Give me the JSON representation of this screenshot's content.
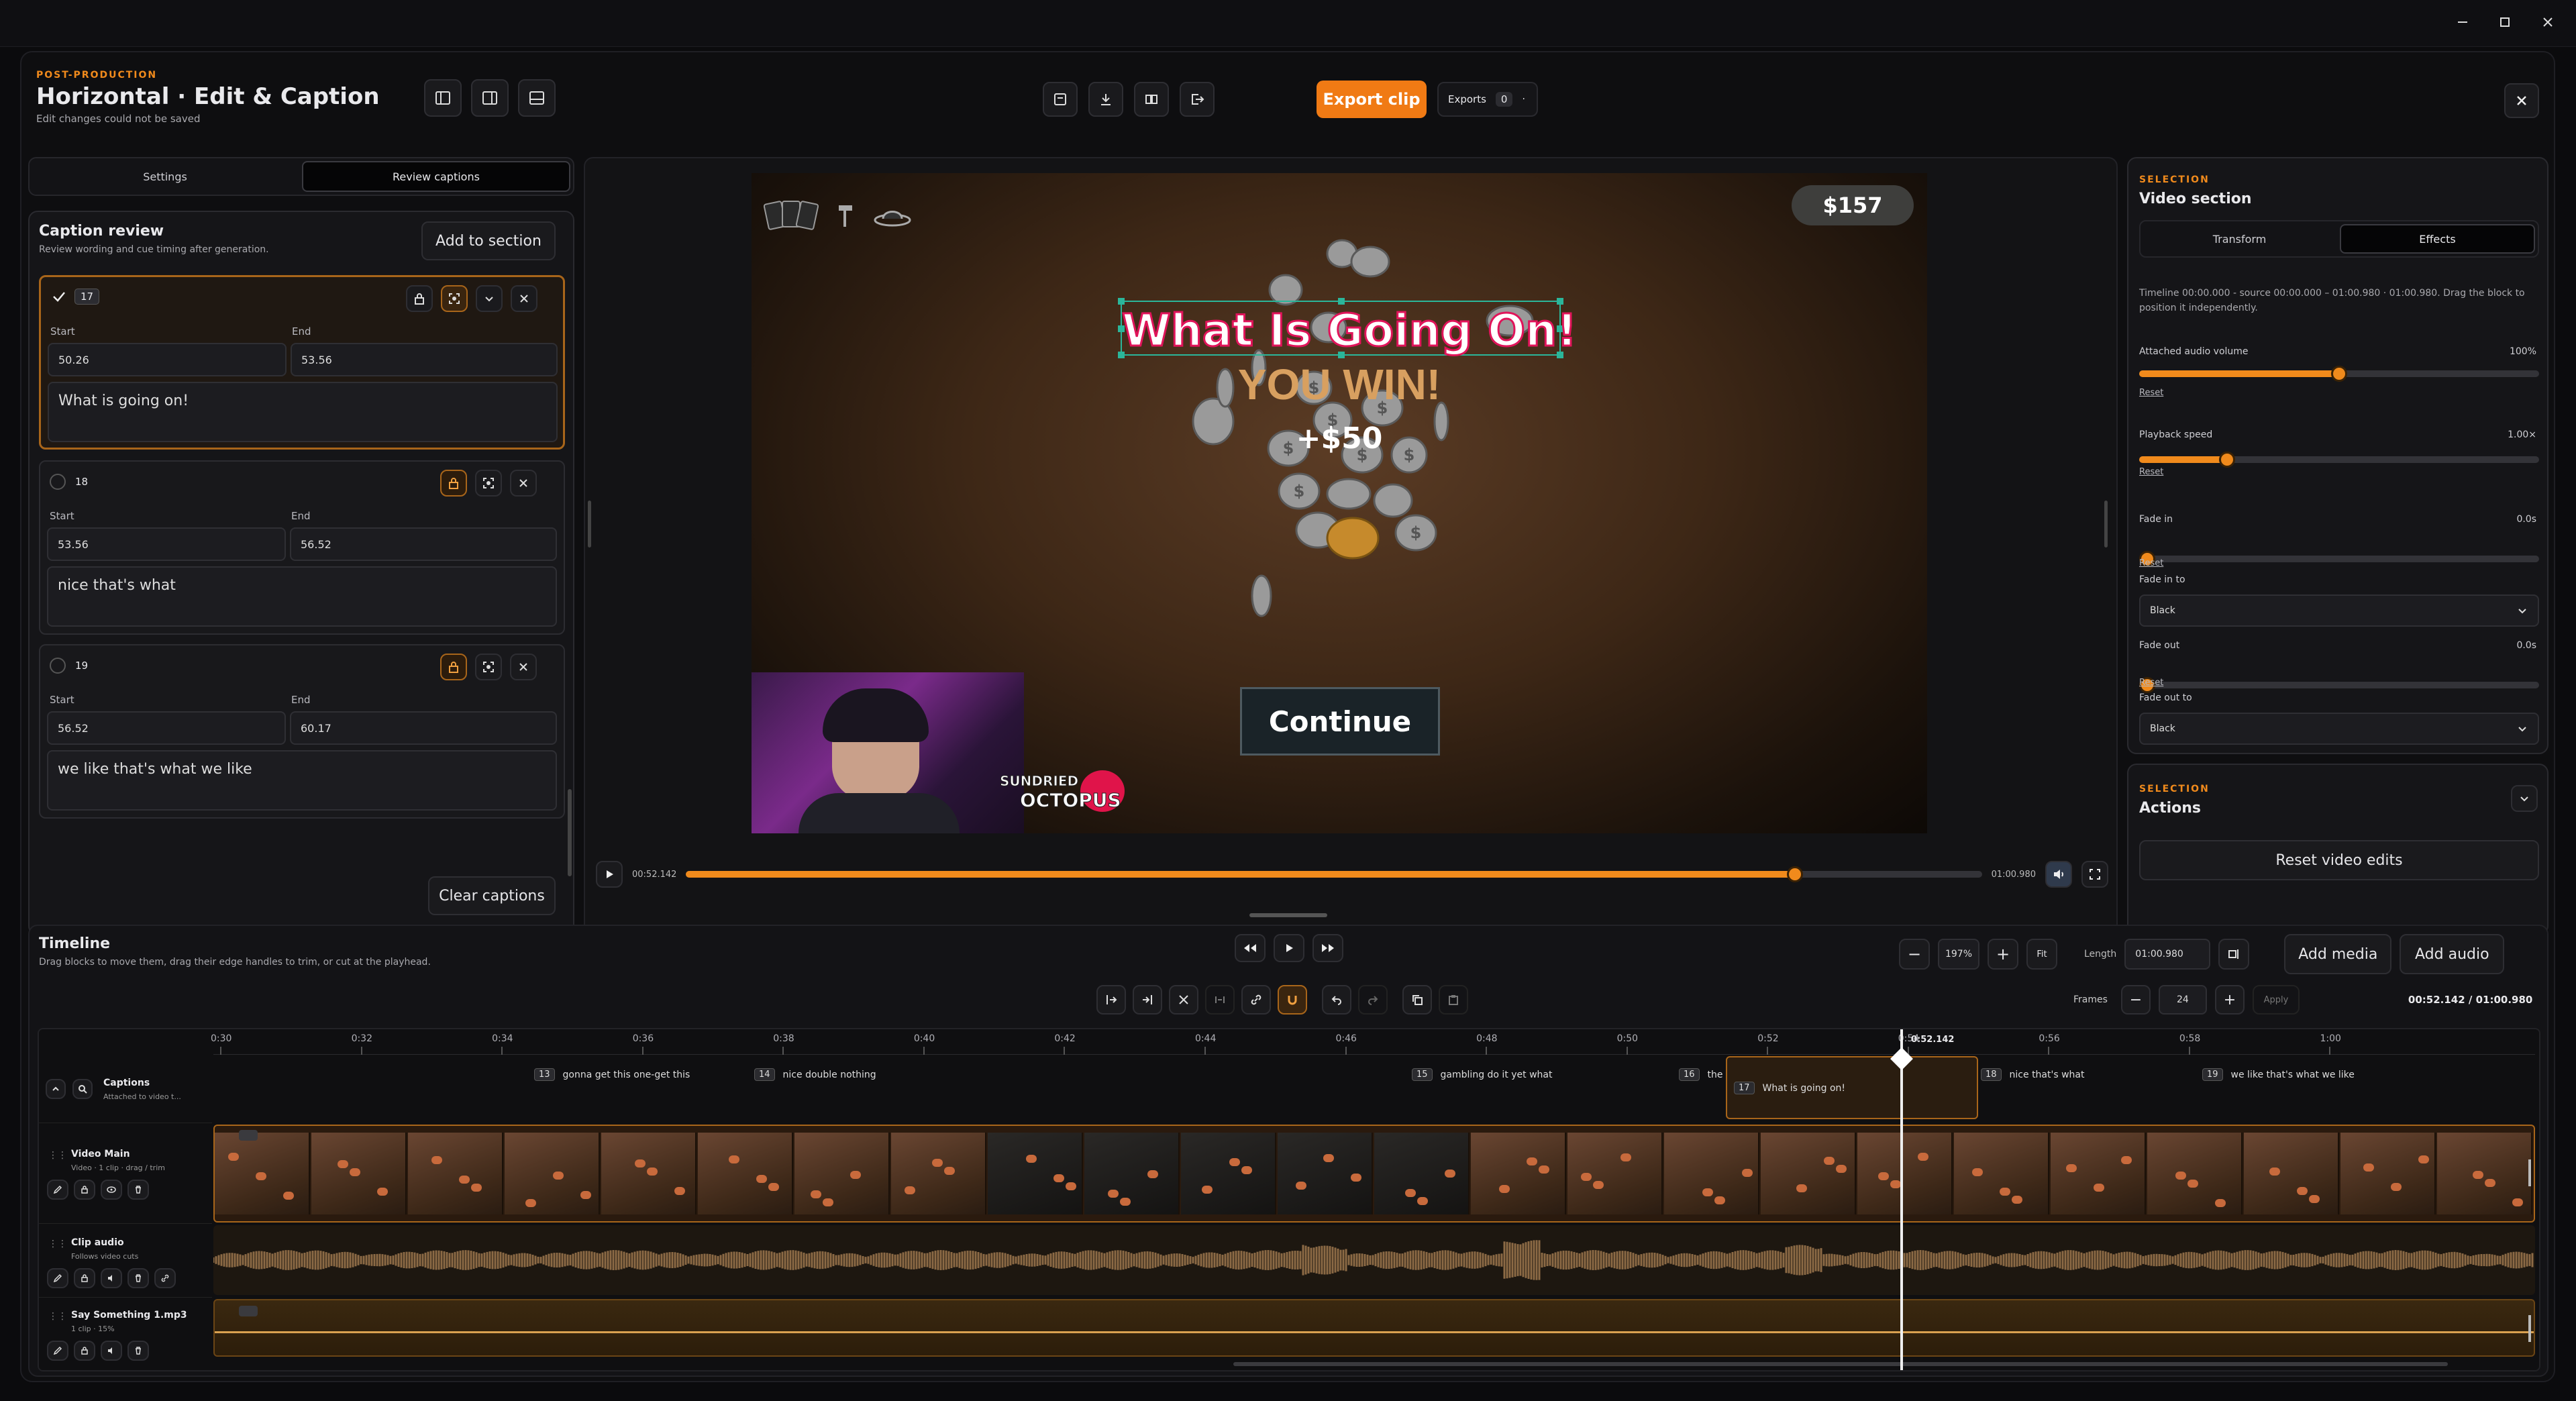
{
  "header": {
    "eyebrow": "POST-PRODUCTION",
    "title": "Horizontal · Edit & Caption",
    "subtitle": "Edit changes could not be saved",
    "export_label": "Export clip",
    "exports_label": "Exports",
    "exports_count": "0"
  },
  "left_panel": {
    "tabs": [
      {
        "label": "Settings"
      },
      {
        "label": "Review captions"
      }
    ],
    "title": "Caption review",
    "description": "Review wording and cue timing after generation.",
    "add_section": "Add to section",
    "clear": "Clear captions",
    "start_label": "Start",
    "end_label": "End",
    "cues": [
      {
        "num": "17",
        "start": "50.26",
        "end": "53.56",
        "text": "What is going on!"
      },
      {
        "num": "18",
        "start": "53.56",
        "end": "56.52",
        "text": "nice that's what"
      },
      {
        "num": "19",
        "start": "56.52",
        "end": "60.17",
        "text": "we like that's what we like"
      }
    ]
  },
  "preview": {
    "caption": "What Is Going On!",
    "you_win": "YOU WIN!",
    "plus": "+$50",
    "continue": "Continue",
    "money": "$157",
    "logo_line1": "SUNDRIED",
    "logo_line2": "OCTOPUS",
    "time_current": "00:52.142",
    "time_total": "01:00.980",
    "progress": 0.856
  },
  "right_panel": {
    "eyebrow": "SELECTION",
    "title": "Video section",
    "tabs": [
      {
        "label": "Transform"
      },
      {
        "label": "Effects"
      }
    ],
    "info": "Timeline 00:00.000 - source 00:00.000 – 01:00.980 · 01:00.980. Drag the block to position it independently.",
    "reset": "Reset",
    "volume": {
      "label": "Attached audio volume",
      "value": "100%",
      "level": 0.5
    },
    "speed": {
      "label": "Playback speed",
      "value": "1.00×",
      "level": 0.22
    },
    "fade_in": {
      "label": "Fade in",
      "value": "0.0s",
      "level": 0
    },
    "fade_in_to": {
      "label": "Fade in to",
      "value": "Black"
    },
    "fade_out": {
      "label": "Fade out",
      "value": "0.0s",
      "level": 0
    },
    "fade_out_to": {
      "label": "Fade out to",
      "value": "Black"
    },
    "actions_eyebrow": "SELECTION",
    "actions_title": "Actions",
    "reset_video": "Reset video edits"
  },
  "timeline": {
    "title": "Timeline",
    "description": "Drag blocks to move them, drag their edge handles to trim, or cut at the playhead.",
    "zoom": "197%",
    "fit": "Fit",
    "length_label": "Length",
    "length": "01:00.980",
    "add_media": "Add media",
    "add_audio": "Add audio",
    "frames_label": "Frames",
    "frames": "24",
    "apply": "Apply",
    "time_readout": "00:52.142 / 01:00.980",
    "playhead_label": "0:52.142",
    "ticks": [
      "0:30",
      "0:32",
      "0:34",
      "0:36",
      "0:38",
      "0:40",
      "0:42",
      "0:44",
      "0:46",
      "0:48",
      "0:50",
      "0:52",
      "0:54",
      "0:56",
      "0:58",
      "1:00"
    ],
    "tracks": [
      {
        "name": "Captions",
        "sub": "Attached to video t..."
      },
      {
        "name": "Video Main",
        "sub": "Video · 1 clip · drag / trim"
      },
      {
        "name": "Clip audio",
        "sub": "Follows video cuts"
      },
      {
        "name": "Say Something 1.mp3",
        "sub": "1 clip · 15%"
      }
    ],
    "captions": [
      {
        "num": "13",
        "text": "gonna get this one-get this"
      },
      {
        "num": "14",
        "text": "nice double nothing"
      },
      {
        "num": "15",
        "text": "gambling do it yet what"
      },
      {
        "num": "16",
        "text": "the"
      },
      {
        "num": "17",
        "text": "What is going on!"
      },
      {
        "num": "18",
        "text": "nice that's what"
      },
      {
        "num": "19",
        "text": "we like that's what we like"
      }
    ]
  },
  "colors": {
    "accent": "#f08a1c",
    "bg": "#0b0b0d",
    "caption_outline": "#e0145a"
  }
}
